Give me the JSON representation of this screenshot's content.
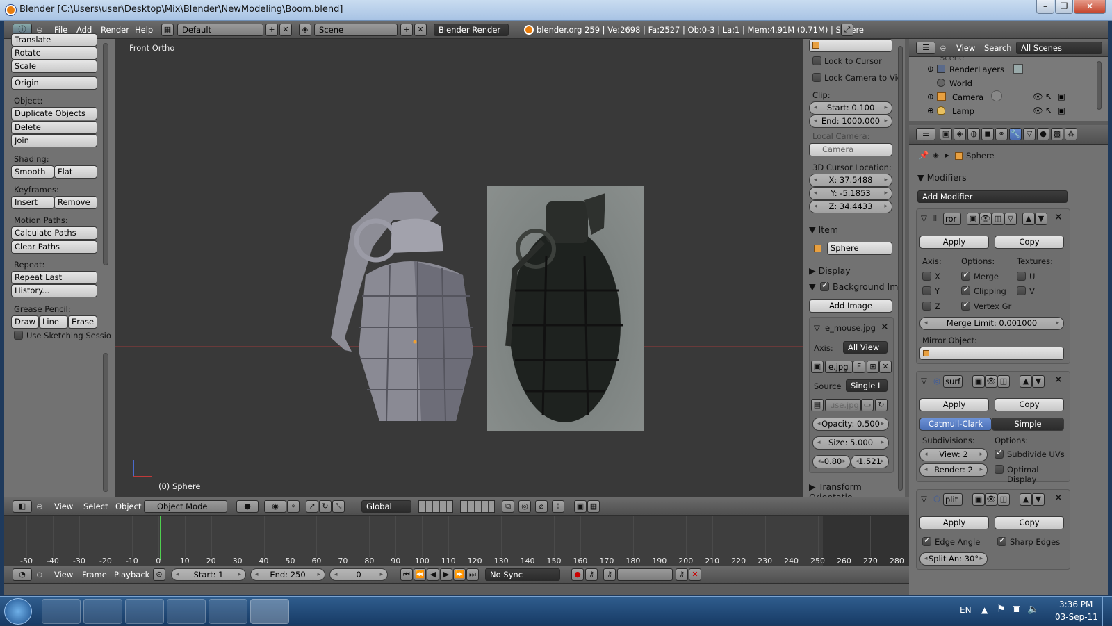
{
  "window": {
    "title": "Blender [C:\\Users\\user\\Desktop\\Mix\\Blender\\NewModeling\\Boom.blend]",
    "controls": [
      "–",
      "❐",
      "✕"
    ]
  },
  "info_header": {
    "menus": [
      "File",
      "Add",
      "Render",
      "Help"
    ],
    "layout": "Default",
    "scene": "Scene",
    "engine": "Blender Render",
    "stats": "blender.org 259 | Ve:2698 | Fa:2527 | Ob:0-3 | La:1 | Mem:4.91M (0.71M) | Sphere"
  },
  "toolshelf": {
    "top_partial": "Translate",
    "transform_buttons": [
      "Rotate",
      "Scale"
    ],
    "origin": "Origin",
    "object_label": "Object:",
    "object_buttons": [
      "Duplicate Objects",
      "Delete",
      "Join"
    ],
    "shading_label": "Shading:",
    "shading_buttons": [
      "Smooth",
      "Flat"
    ],
    "keyframes_label": "Keyframes:",
    "keyframe_buttons": [
      "Insert",
      "Remove"
    ],
    "motion_label": "Motion Paths:",
    "motion_buttons": [
      "Calculate Paths",
      "Clear Paths"
    ],
    "repeat_label": "Repeat:",
    "repeat_buttons": [
      "Repeat Last",
      "History..."
    ],
    "grease_label": "Grease Pencil:",
    "grease_buttons": [
      "Draw",
      "Line",
      "Erase"
    ],
    "sketching": "Use Sketching Sessio"
  },
  "viewport": {
    "view_name": "Front Ortho",
    "object_info": "(0) Sphere"
  },
  "view3d_header": {
    "menus": [
      "View",
      "Select",
      "Object"
    ],
    "mode": "Object Mode",
    "orientation": "Global"
  },
  "properties_n": {
    "lock_cursor": "Lock to Cursor",
    "lock_camera": "Lock Camera to Vie",
    "clip_label": "Clip:",
    "clip_start": "Start: 0.100",
    "clip_end": "End: 1000.000",
    "local_camera": "Local Camera:",
    "camera": "Camera",
    "cursor_label": "3D Cursor Location:",
    "cursor_x": "X: 37.5488",
    "cursor_y": "Y: -5.1853",
    "cursor_z": "Z: 34.4433",
    "item": "Item",
    "item_name": "Sphere",
    "display": "Display",
    "background": "Background Ima",
    "add_image": "Add Image",
    "image_name": "e_mouse.jpg",
    "axis_label": "Axis:",
    "axis_value": "All View",
    "img_short": "e.jpg",
    "img_f": "F",
    "source_label": "Source",
    "source_value": "Single I",
    "use_jpg": "use.jpg",
    "opacity": "Opacity: 0.500",
    "size": "Size: 5.000",
    "offset_x": "-0.80",
    "offset_y": "1.521",
    "transform_orient": "Transform Orientatio"
  },
  "outliner": {
    "menus": [
      "View",
      "Search"
    ],
    "filter": "All Scenes",
    "items": [
      "Scene",
      "RenderLayers",
      "World",
      "Camera",
      "Lamp"
    ]
  },
  "properties": {
    "object": "Sphere",
    "modifiers_label": "Modifiers",
    "add_modifier": "Add Modifier",
    "mirror": {
      "name": "ror",
      "apply": "Apply",
      "copy": "Copy",
      "axis_label": "Axis:",
      "options_label": "Options:",
      "textures_label": "Textures:",
      "axes": [
        "X",
        "Y",
        "Z"
      ],
      "options": [
        "Merge",
        "Clipping",
        "Vertex Gr"
      ],
      "textures": [
        "U",
        "V"
      ],
      "merge_limit": "Merge Limit: 0.001000",
      "mirror_object": "Mirror Object:"
    },
    "subsurf": {
      "name": "surf",
      "apply": "Apply",
      "copy": "Copy",
      "catmull": "Catmull-Clark",
      "simple": "Simple",
      "subdivisions": "Subdivisions:",
      "options_label": "Options:",
      "view": "View: 2",
      "render": "Render: 2",
      "subdivide_uvs": "Subdivide UVs",
      "optimal": "Optimal Display"
    },
    "split": {
      "name": "plit",
      "apply": "Apply",
      "copy": "Copy",
      "edge_angle": "Edge Angle",
      "sharp_edges": "Sharp Edges",
      "split_angle": "Split An: 30°"
    }
  },
  "timeline": {
    "ticks": [
      "-50",
      "-40",
      "-30",
      "-20",
      "-10",
      "0",
      "10",
      "20",
      "30",
      "40",
      "50",
      "60",
      "70",
      "80",
      "90",
      "100",
      "110",
      "120",
      "130",
      "140",
      "150",
      "160",
      "170",
      "180",
      "190",
      "200",
      "210",
      "220",
      "230",
      "240",
      "250",
      "260",
      "270",
      "280"
    ],
    "menus": [
      "View",
      "Frame",
      "Playback"
    ],
    "start": "Start: 1",
    "end": "End: 250",
    "current": "0",
    "sync": "No Sync"
  },
  "taskbar": {
    "lang": "EN",
    "time": "3:36 PM",
    "date": "03-Sep-11"
  },
  "colors": {
    "accent_blue": "#5680c2",
    "viewport_bg": "#393939",
    "blender_orange": "#e87d0d"
  }
}
